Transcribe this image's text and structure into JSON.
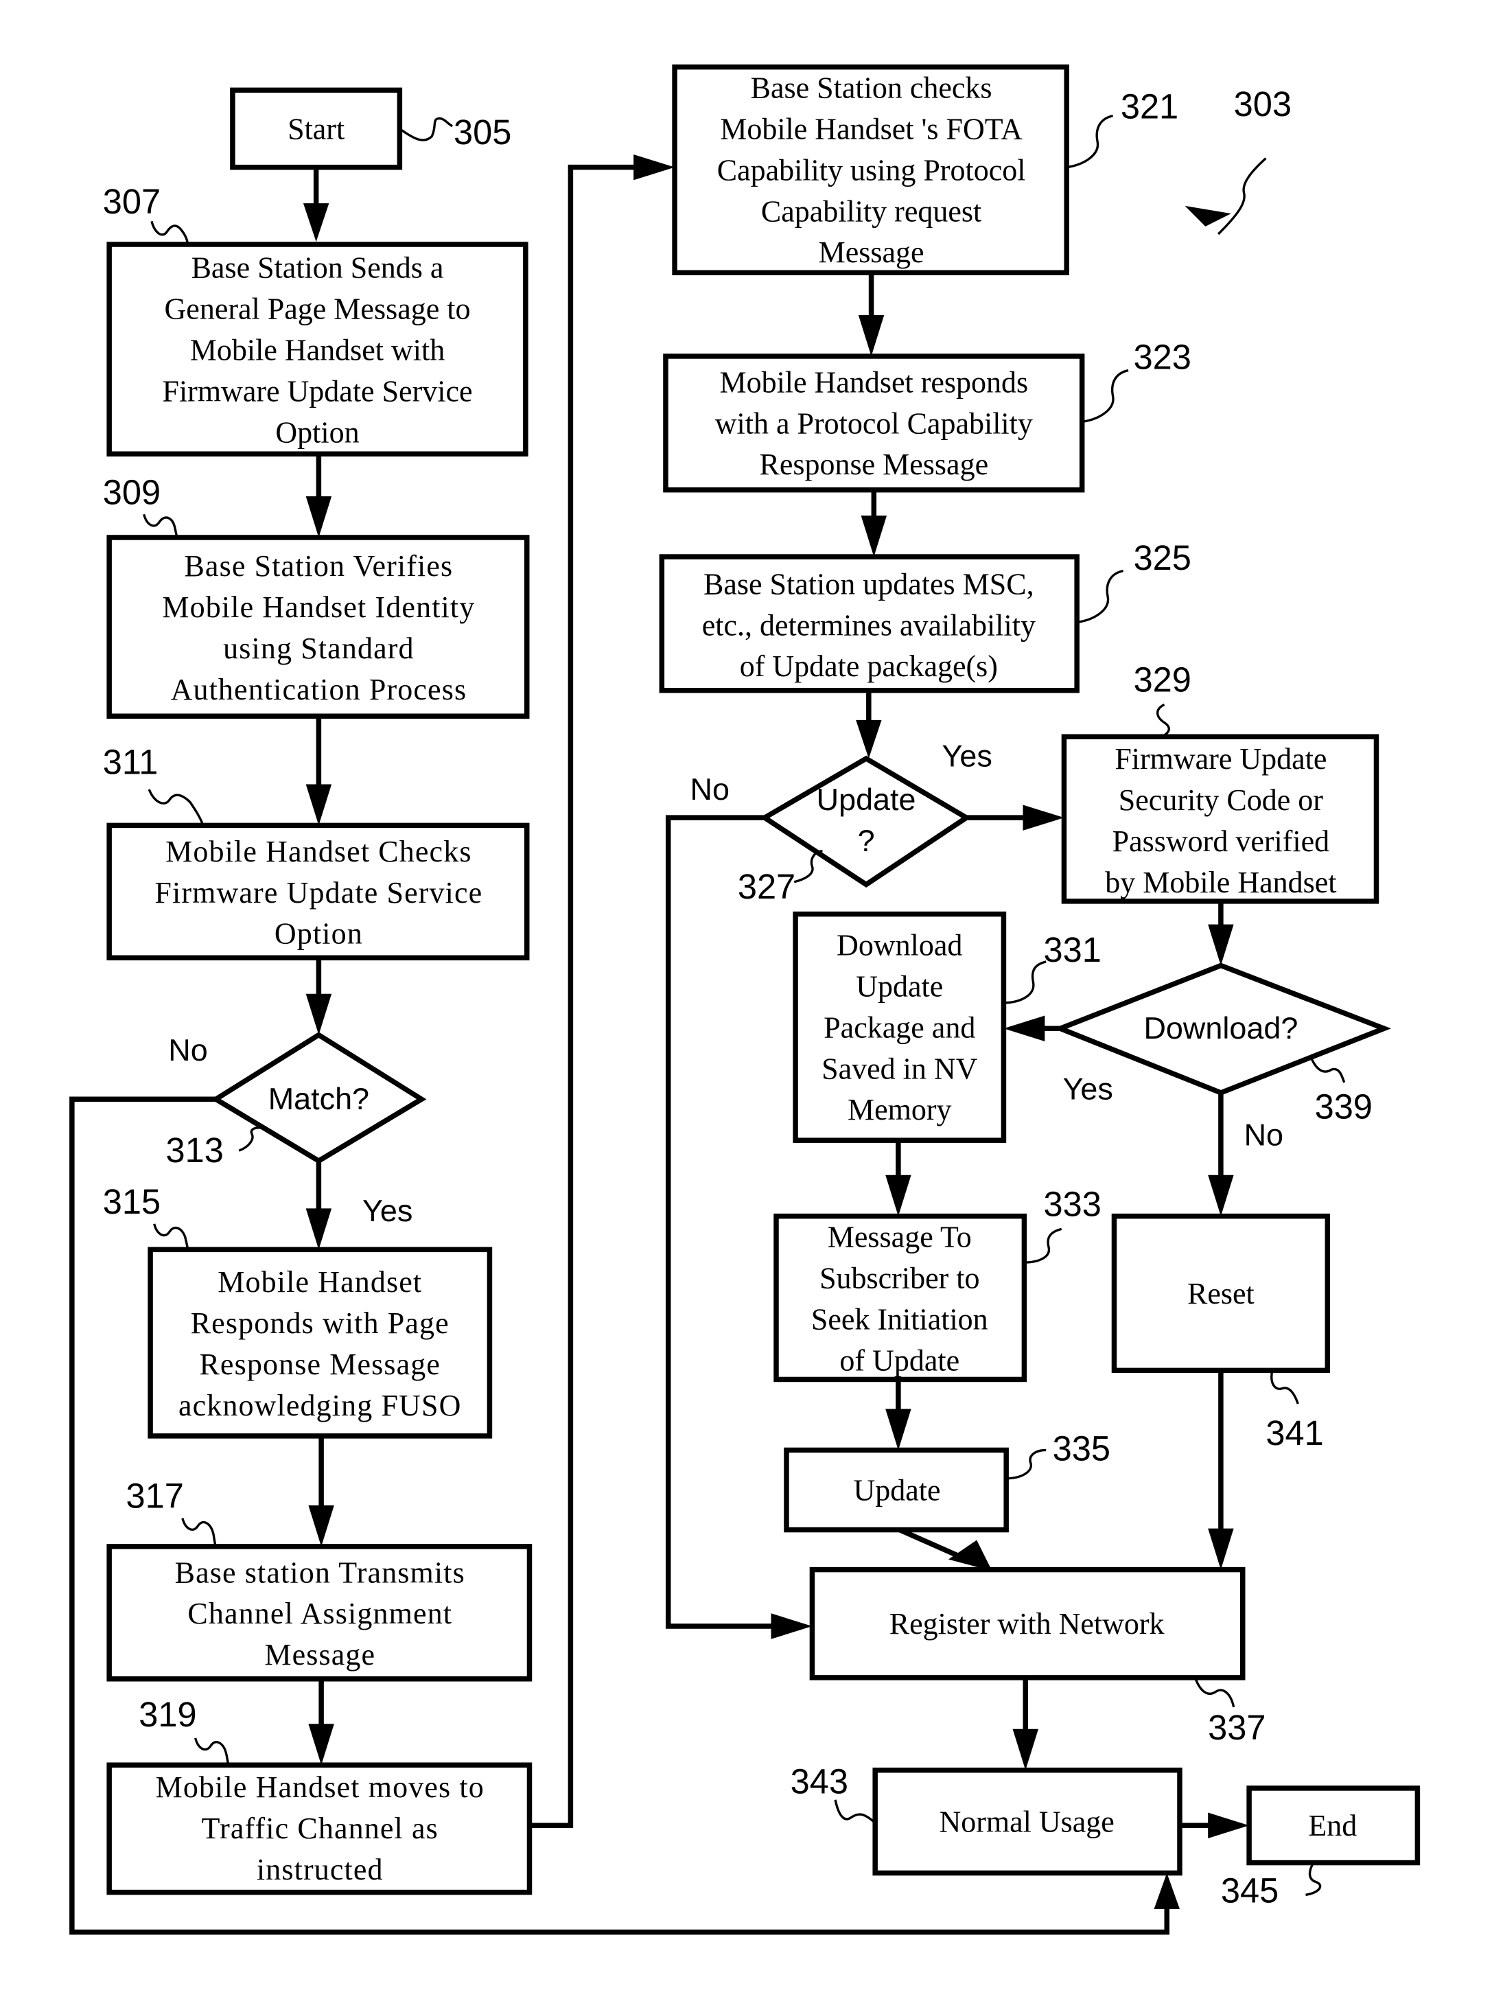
{
  "figure_ref": "303",
  "nodes": {
    "start": {
      "ref": "305",
      "lines": [
        "Start"
      ]
    },
    "n307": {
      "ref": "307",
      "lines": [
        "Base Station Sends a",
        "General Page Message to",
        "Mobile Handset with",
        "Firmware Update Service",
        "Option"
      ]
    },
    "n309": {
      "ref": "309",
      "lines": [
        "Base Station Verifies",
        "Mobile Handset Identity",
        "using Standard",
        "Authentication Process"
      ]
    },
    "n311": {
      "ref": "311",
      "lines": [
        "Mobile Handset Checks",
        "Firmware Update Service",
        "Option"
      ]
    },
    "match": {
      "ref": "313",
      "lines": [
        "Match?"
      ]
    },
    "n315": {
      "ref": "315",
      "lines": [
        "Mobile Handset",
        "Responds with Page",
        "Response Message",
        "acknowledging FUSO"
      ]
    },
    "n317": {
      "ref": "317",
      "lines": [
        "Base station Transmits",
        "Channel Assignment",
        "Message"
      ]
    },
    "n319": {
      "ref": "319",
      "lines": [
        "Mobile Handset moves to",
        "Traffic Channel as",
        "instructed"
      ]
    },
    "n321": {
      "ref": "321",
      "lines": [
        "Base Station checks",
        "Mobile Handset 's FOTA",
        "Capability using Protocol",
        "Capability request",
        "Message"
      ]
    },
    "n323": {
      "ref": "323",
      "lines": [
        "Mobile Handset responds",
        "with a Protocol Capability",
        "Response Message"
      ]
    },
    "n325": {
      "ref": "325",
      "lines": [
        "Base Station updates MSC,",
        "etc., determines availability",
        "of Update package(s)"
      ]
    },
    "update_q": {
      "ref": "327",
      "lines": [
        "Update",
        "?"
      ]
    },
    "n329": {
      "ref": "329",
      "lines": [
        "Firmware Update",
        "Security Code or",
        "Password verified",
        "by Mobile Handset"
      ]
    },
    "n331": {
      "ref": "331",
      "lines": [
        "Download",
        "Update",
        "Package and",
        "Saved in NV",
        "Memory"
      ]
    },
    "download_q": {
      "ref": "339",
      "lines": [
        "Download?"
      ]
    },
    "n333": {
      "ref": "333",
      "lines": [
        "Message To",
        "Subscriber to",
        "Seek Initiation",
        "of Update"
      ]
    },
    "reset": {
      "ref": "341",
      "lines": [
        "Reset"
      ]
    },
    "n335": {
      "ref": "335",
      "lines": [
        "Update"
      ]
    },
    "register": {
      "ref": "337",
      "lines": [
        "Register with Network"
      ]
    },
    "normal": {
      "ref": "343",
      "lines": [
        "Normal Usage"
      ]
    },
    "end": {
      "ref": "345",
      "lines": [
        "End"
      ]
    }
  },
  "edge_labels": {
    "match_no": "No",
    "match_yes": "Yes",
    "update_no": "No",
    "update_yes": "Yes",
    "download_yes": "Yes",
    "download_no": "No"
  }
}
